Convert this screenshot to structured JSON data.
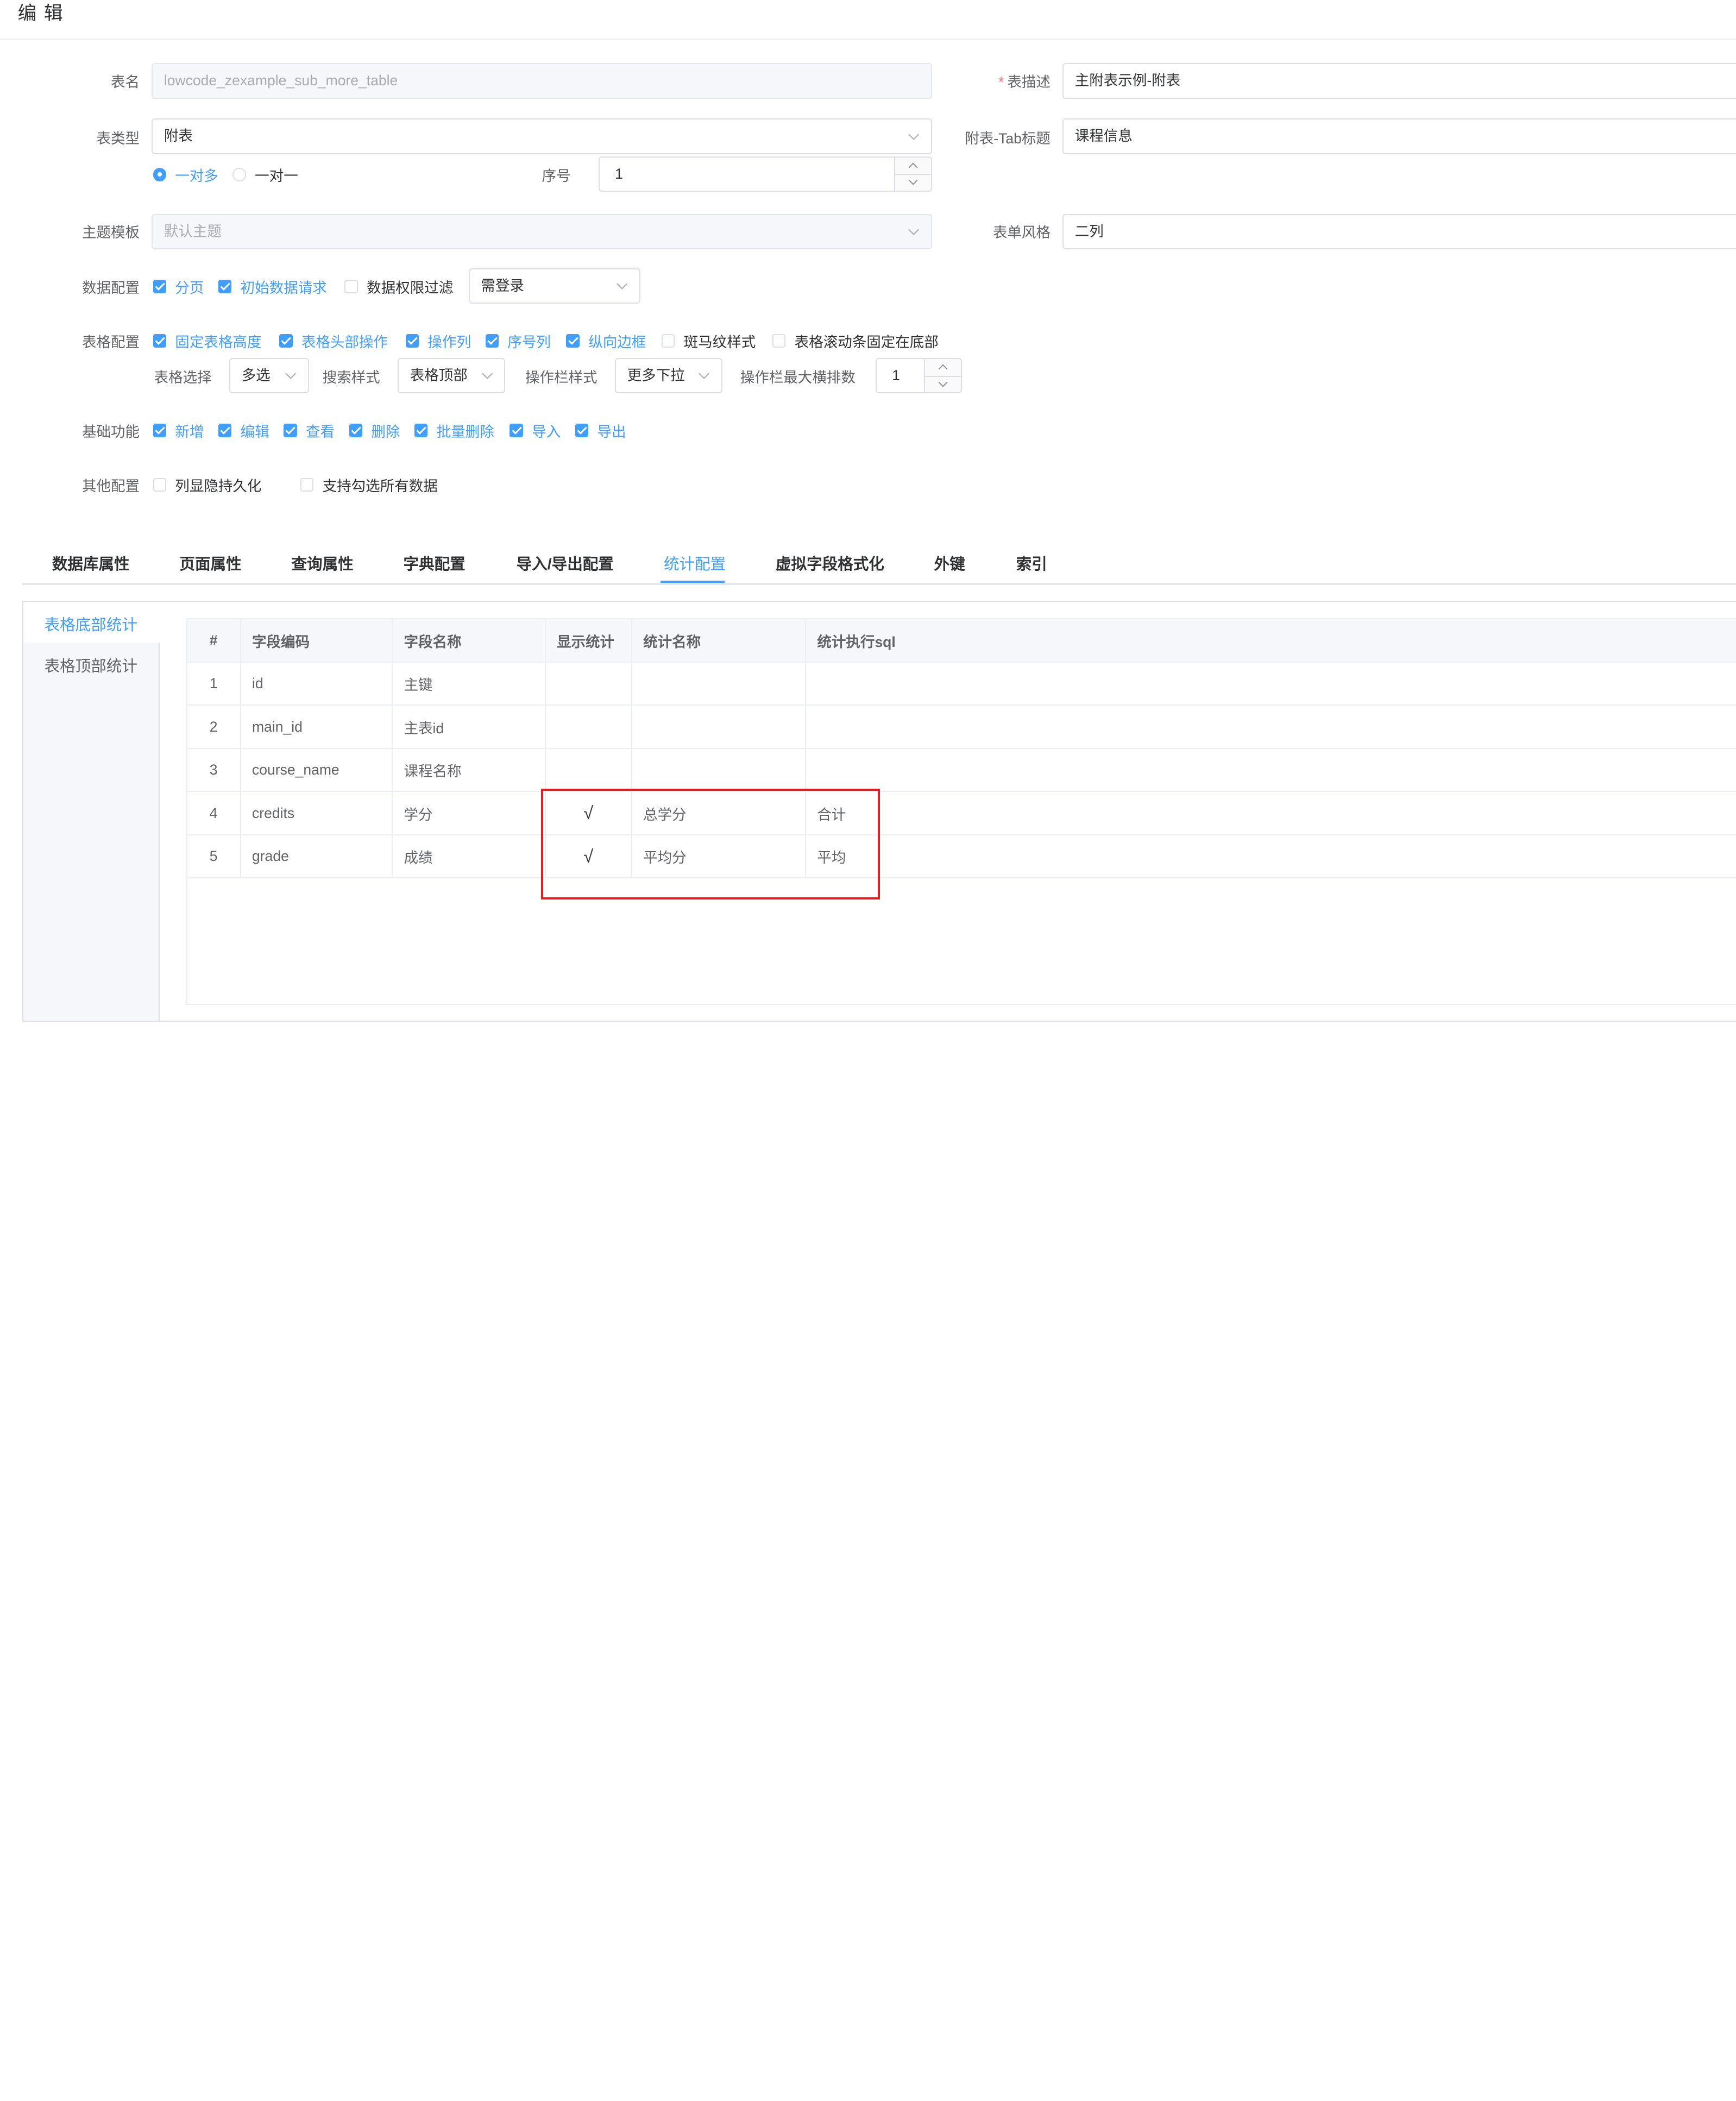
{
  "header": {
    "title": "编 辑"
  },
  "form": {
    "table_name": {
      "label": "表名",
      "value": "lowcode_zexample_sub_more_table"
    },
    "table_desc": {
      "label": "表描述",
      "value": "主附表示例-附表"
    },
    "table_type": {
      "label": "表类型",
      "value": "附表"
    },
    "tab_title": {
      "label": "附表-Tab标题",
      "value": "课程信息"
    },
    "relation": {
      "one_to_many": "一对多",
      "one_to_one": "一对一",
      "selected": "一对多"
    },
    "order": {
      "label": "序号",
      "value": "1"
    },
    "theme": {
      "label": "主题模板",
      "placeholder": "默认主题"
    },
    "form_style": {
      "label": "表单风格",
      "value": "二列"
    },
    "data_config": {
      "label": "数据配置",
      "options": [
        {
          "label": "分页",
          "checked": true
        },
        {
          "label": "初始数据请求",
          "checked": true
        },
        {
          "label": "数据权限过滤",
          "checked": false
        }
      ],
      "login_select": "需登录"
    },
    "table_config": {
      "label": "表格配置",
      "options": [
        {
          "label": "固定表格高度",
          "checked": true
        },
        {
          "label": "表格头部操作",
          "checked": true
        },
        {
          "label": "操作列",
          "checked": true
        },
        {
          "label": "序号列",
          "checked": true
        },
        {
          "label": "纵向边框",
          "checked": true
        },
        {
          "label": "斑马纹样式",
          "checked": false
        },
        {
          "label": "表格滚动条固定在底部",
          "checked": false
        }
      ],
      "select_label": "表格选择",
      "select_value": "多选",
      "search_label": "搜索样式",
      "search_value": "表格顶部",
      "action_label": "操作栏样式",
      "action_value": "更多下拉",
      "max_label": "操作栏最大横排数",
      "max_value": "1"
    },
    "basic": {
      "label": "基础功能",
      "options": [
        {
          "label": "新增",
          "checked": true
        },
        {
          "label": "编辑",
          "checked": true
        },
        {
          "label": "查看",
          "checked": true
        },
        {
          "label": "删除",
          "checked": true
        },
        {
          "label": "批量删除",
          "checked": true
        },
        {
          "label": "导入",
          "checked": true
        },
        {
          "label": "导出",
          "checked": true
        }
      ]
    },
    "other": {
      "label": "其他配置",
      "options": [
        {
          "label": "列显隐持久化",
          "checked": false
        },
        {
          "label": "支持勾选所有数据",
          "checked": false
        }
      ]
    }
  },
  "tabs": [
    "数据库属性",
    "页面属性",
    "查询属性",
    "字典配置",
    "导入/导出配置",
    "统计配置",
    "虚拟字段格式化",
    "外键",
    "索引"
  ],
  "active_tab": "统计配置",
  "side_tabs": [
    "表格底部统计",
    "表格顶部统计"
  ],
  "active_side_tab": "表格底部统计",
  "stats_table": {
    "columns": [
      "#",
      "字段编码",
      "字段名称",
      "显示统计",
      "统计名称",
      "统计执行sql"
    ],
    "rows": [
      [
        "1",
        "id",
        "主键",
        "",
        "",
        ""
      ],
      [
        "2",
        "main_id",
        "主表id",
        "",
        "",
        ""
      ],
      [
        "3",
        "course_name",
        "课程名称",
        "",
        "",
        ""
      ],
      [
        "4",
        "credits",
        "学分",
        "√",
        "总学分",
        "合计"
      ],
      [
        "5",
        "grade",
        "成绩",
        "√",
        "平均分",
        "平均"
      ]
    ]
  },
  "colors": {
    "primary": "#409eff",
    "highlight_border": "#e02020"
  }
}
